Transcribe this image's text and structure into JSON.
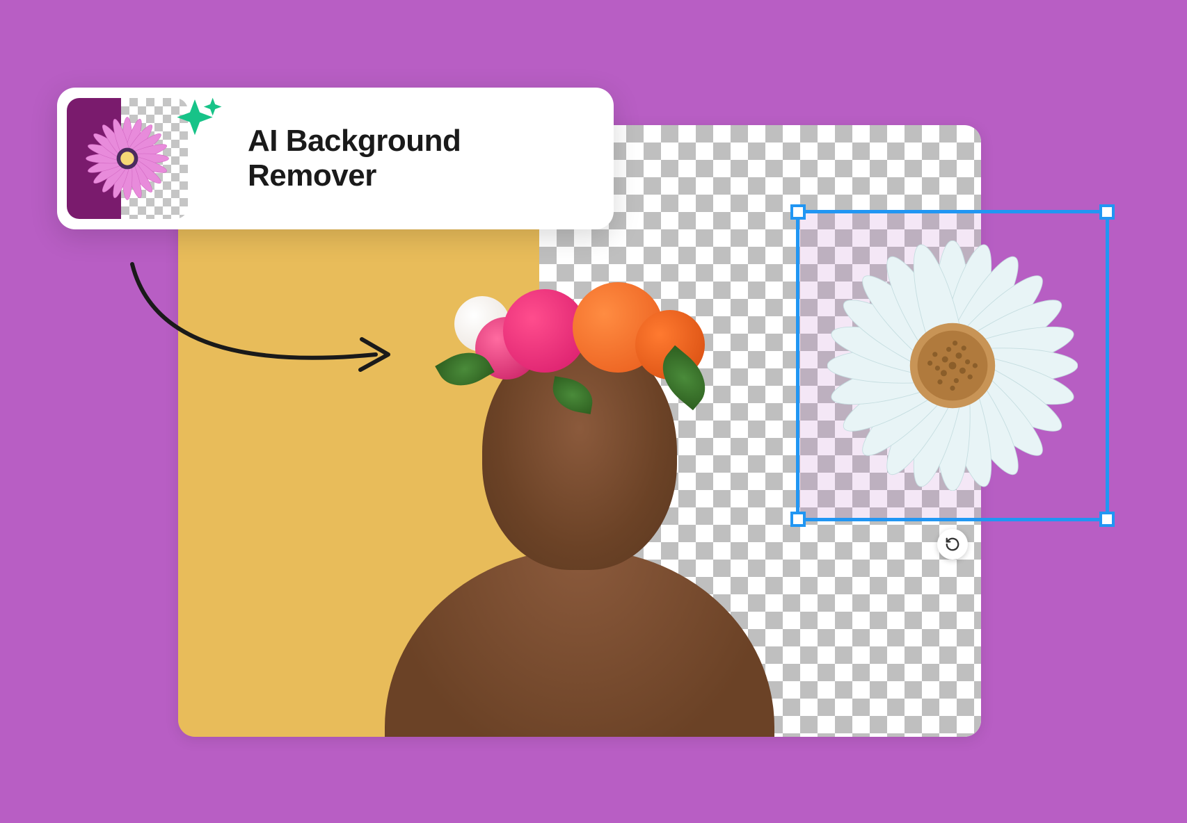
{
  "tool": {
    "label": "AI Background Remover",
    "thumb_icon": "pink-daisy-flower",
    "sparkle_icon": "ai-sparkle"
  },
  "canvas": {
    "subject": "person-with-flower-crown",
    "background_left": "solid-yellow",
    "background_right": "transparent-checker",
    "selection": {
      "object": "white-daisy-flower",
      "rotate_icon": "rotate-ccw"
    }
  },
  "colors": {
    "page_bg": "#B85EC4",
    "selection_border": "#2196F3",
    "sparkle": "#17C388"
  }
}
